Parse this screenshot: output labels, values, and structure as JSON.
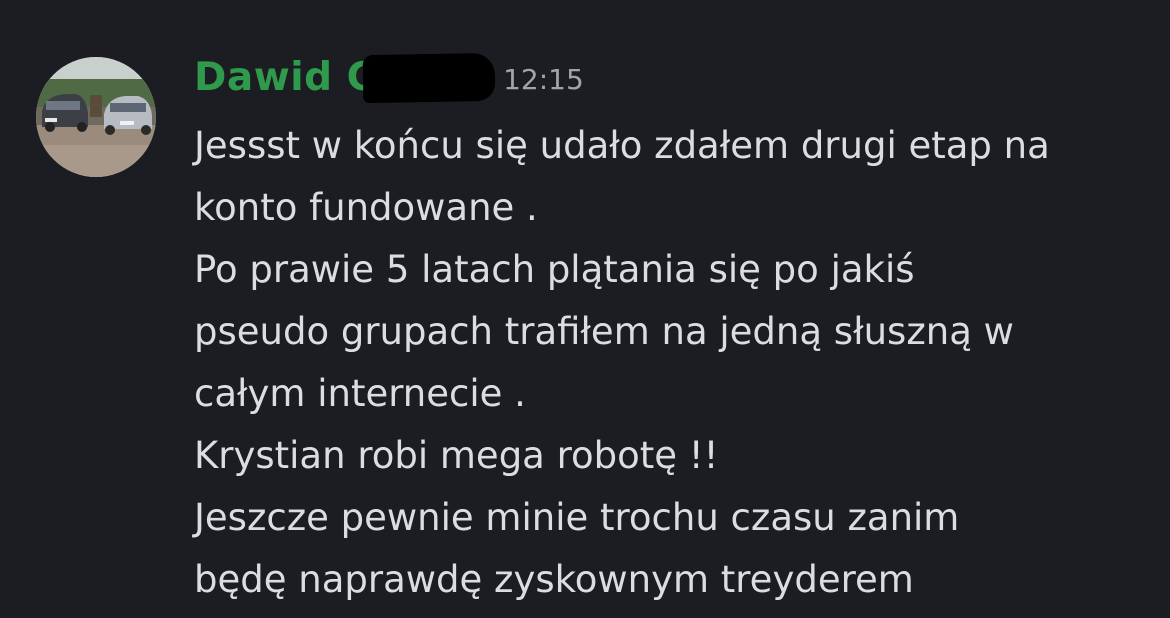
{
  "message": {
    "author": {
      "name": "Dawid  G",
      "name_color": "#2f9a4c",
      "avatar": "avatar-photo-cars"
    },
    "timestamp": "12:15",
    "lines": [
      "Jessst w końcu się udało zdałem drugi etap na",
      "konto fundowane .",
      "Po prawie 5 latach plątania się po jakiś",
      "pseudo grupach trafiłem na jedną słuszną w",
      "całym internecie .",
      "Krystian robi mega robotę !!",
      "Jeszcze pewnie minie trochu czasu zanim",
      "będę naprawdę zyskownym treyderem"
    ]
  },
  "theme": {
    "background": "#1c1d22",
    "text": "#dcdde1",
    "timestamp": "#a2a4aa"
  }
}
